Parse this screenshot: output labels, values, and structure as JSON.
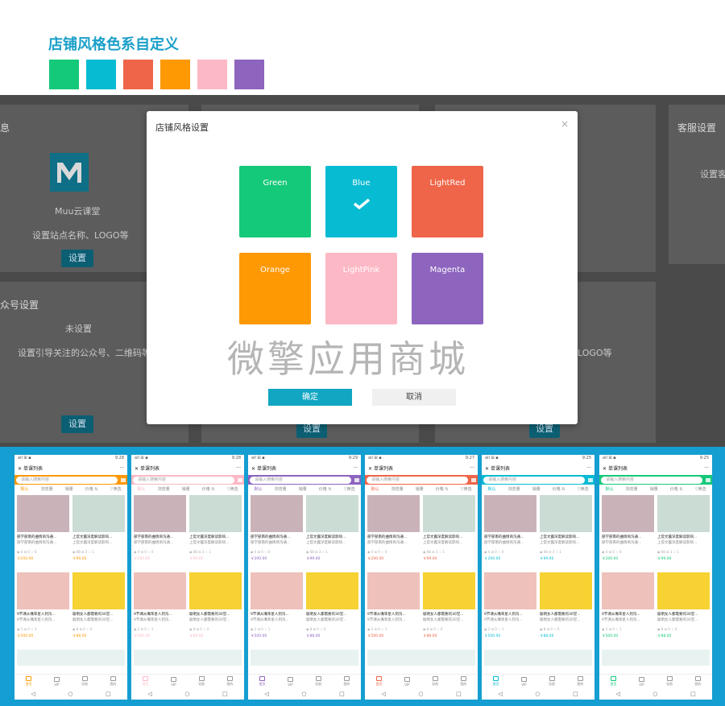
{
  "header": {
    "title": "店铺风格色系自定义",
    "swatches": [
      "#15c97a",
      "#07bbd2",
      "#ee6549",
      "#fe9803",
      "#fdb8c5",
      "#8d64be"
    ]
  },
  "admin": {
    "card1_title": "息",
    "card1_name": "Muu云课堂",
    "card1_desc": "设置站点名称、LOGO等",
    "card1_btn": "设置",
    "card2_title": "众号设置",
    "card2_status": "未设置",
    "card2_desc": "设置引导关注的公众号、二维码等",
    "card2_btn": "设置",
    "card3_title": "客服设置",
    "card3_desc": "设置客",
    "card4_desc": "LOGO等",
    "mid_btn1": "设置",
    "mid_btn2": "设置"
  },
  "modal": {
    "title": "店铺风格设置",
    "close": "×",
    "colors": [
      {
        "name": "Green",
        "color": "#15c97a",
        "selected": false
      },
      {
        "name": "Blue",
        "color": "#07bbd2",
        "selected": true
      },
      {
        "name": "LightRed",
        "color": "#ee6549",
        "selected": false
      },
      {
        "name": "Orange",
        "color": "#fe9803",
        "selected": false
      },
      {
        "name": "LightPink",
        "color": "#fdb8c5",
        "selected": false
      },
      {
        "name": "Magenta",
        "color": "#8d64be",
        "selected": false
      }
    ],
    "watermark": "微擎应用商城",
    "ok": "确定",
    "cancel": "取消"
  },
  "phones": {
    "accents": [
      "#fe9803",
      "#fdb8c5",
      "#8d64be",
      "#ee6549",
      "#07bbd2",
      "#15c97a"
    ],
    "status_left": "all ⊞ ▪",
    "status_times": [
      "9:28",
      "9:28",
      "9:29",
      "9:27",
      "9:25",
      "9:25"
    ],
    "nav_title": "单课列表",
    "nav_close": "✕",
    "nav_more": "···",
    "search_placeholder": "请输入搜索内容",
    "filters": [
      "默认",
      "浏览量",
      "销量",
      "价格 ⇅",
      "▽筛选"
    ],
    "cards": [
      {
        "t1": "部学部南的曲情商沟通...",
        "t2": "部学部南的曲情商沟通...",
        "meta": "◉ 4  ⊞ 0  ☆ 0",
        "price": "￥200.00"
      },
      {
        "t1": "上官文露深度解读影响...",
        "t2": "上官文露深度解读影响...",
        "meta": "◉ 68  ⊞ 3  ☆ 1",
        "price": "￥99.00"
      },
      {
        "t1": "9节课从嘴笨星人到沟...",
        "t2": "9节课从嘴笨星人到沟...",
        "meta": "◉ 2  ⊞ 0  ☆ 1",
        "price": "￥500.00"
      },
      {
        "t1": "聪明女人都需要的30堂...",
        "t2": "聪明女人都需要的30堂...",
        "meta": "◉ 8  ⊞ 0  ☆ 0",
        "price": "￥88.00"
      }
    ],
    "tabs": [
      "首页",
      "VIP",
      "导航",
      "我的"
    ],
    "sys": [
      "◁",
      "○",
      "□"
    ]
  }
}
